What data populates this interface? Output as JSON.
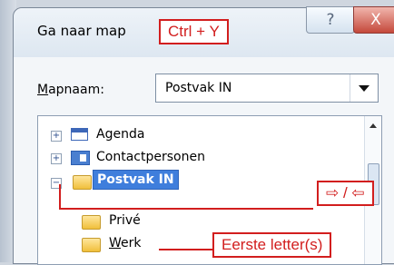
{
  "dialog": {
    "title": "Ga naar map",
    "shortcut_callout": "Ctrl + Y",
    "help_glyph": "?",
    "close_glyph": "X"
  },
  "folder_field": {
    "label_prefix": "M",
    "label_rest": "apnaam:",
    "value": "Postvak IN"
  },
  "tree": {
    "items": [
      {
        "label": "Agenda",
        "icon": "calendar-icon"
      },
      {
        "label": "Contactpersonen",
        "icon": "contacts-icon"
      },
      {
        "label": "Postvak IN",
        "icon": "inbox-folder-icon",
        "selected": true
      },
      {
        "label": "Privé",
        "icon": "folder-icon"
      },
      {
        "label_prefix": "W",
        "label_rest": "erk",
        "icon": "folder-icon"
      }
    ],
    "arrow_callout": "⇨ / ⇦",
    "letter_callout": "Eerste letter(s)"
  },
  "colors": {
    "callout_red": "#d21e1e",
    "selection_blue": "#3f7edc"
  }
}
